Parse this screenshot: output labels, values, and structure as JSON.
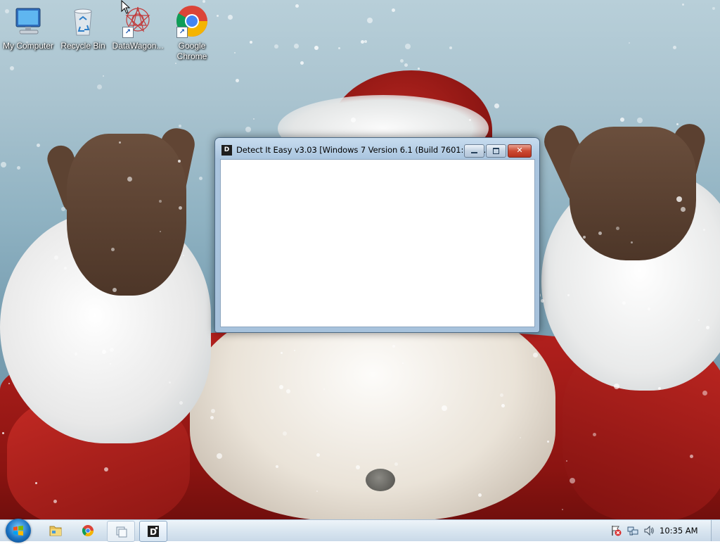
{
  "desktop": {
    "icons": [
      {
        "label": "My Computer",
        "icon": "computer-icon"
      },
      {
        "label": "Recycle Bin",
        "icon": "recycle-bin-icon"
      },
      {
        "label": "DataWagon...",
        "icon": "datawagon-icon"
      },
      {
        "label_line1": "Google",
        "label_line2": "Chrome",
        "icon": "chrome-icon"
      }
    ]
  },
  "window": {
    "title": "Detect It Easy v3.03 [Windows 7 Version 6.1 (Build 7601: SP ...",
    "app_icon_text": "D",
    "controls": {
      "minimize": "minimize",
      "maximize": "maximize",
      "close": "close"
    }
  },
  "taskbar": {
    "pinned": [
      "Windows Explorer",
      "Google Chrome",
      "Switch between windows",
      "Detect It Easy"
    ],
    "tray": {
      "clock": "10:35 AM",
      "icons": [
        "action-center-icon",
        "network-icon",
        "volume-icon"
      ]
    }
  },
  "colors": {
    "titlebar": "#aac5df",
    "close_button": "#cc4a33",
    "taskbar": "#dbe7f1"
  }
}
